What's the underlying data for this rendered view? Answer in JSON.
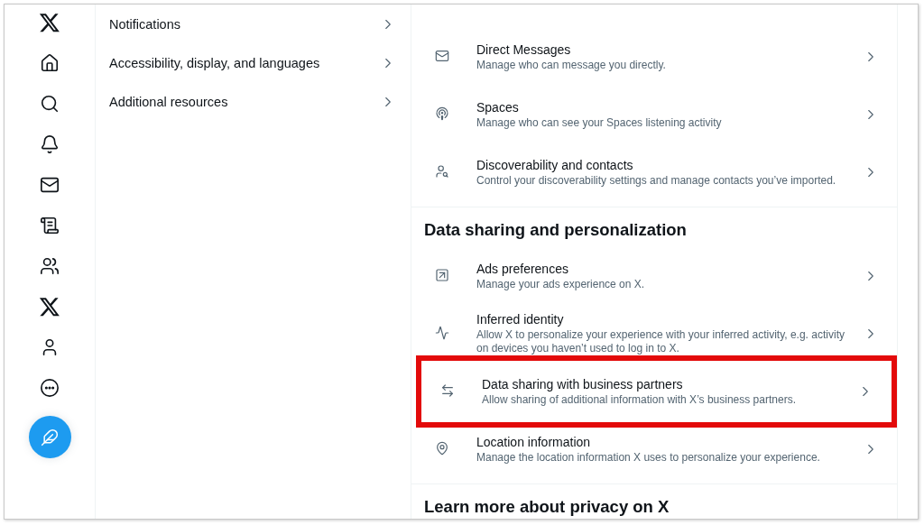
{
  "nav": [
    {
      "kind": "logo"
    },
    {
      "kind": "home"
    },
    {
      "kind": "search"
    },
    {
      "kind": "bell"
    },
    {
      "kind": "mail"
    },
    {
      "kind": "list"
    },
    {
      "kind": "people"
    },
    {
      "kind": "logo"
    },
    {
      "kind": "person"
    },
    {
      "kind": "more"
    },
    {
      "kind": "compose"
    }
  ],
  "settings_menu": [
    {
      "label": "Notifications"
    },
    {
      "label": "Accessibility, display, and languages"
    },
    {
      "label": "Additional resources"
    }
  ],
  "sections": [
    {
      "items": [
        {
          "title": "Direct Messages",
          "description": "Manage who can message you directly.",
          "highlighted": false
        },
        {
          "title": "Spaces",
          "description": "Manage who can see your Spaces listening activity",
          "highlighted": false
        },
        {
          "title": "Discoverability and contacts",
          "description": "Control your discoverability settings and manage contacts you’ve imported.",
          "highlighted": false
        }
      ]
    },
    {
      "heading": "Data sharing and personalization",
      "items": [
        {
          "title": "Ads preferences",
          "description": "Manage your ads experience on X.",
          "highlighted": false
        },
        {
          "title": "Inferred identity",
          "description": "Allow X to personalize your experience with your inferred activity, e.g. activity on devices you haven’t used to log in to X.",
          "highlighted": false
        },
        {
          "title": "Data sharing with business partners",
          "description": "Allow sharing of additional information with X’s business partners.",
          "highlighted": true
        },
        {
          "title": "Location information",
          "description": "Manage the location information X uses to personalize your experience.",
          "highlighted": false
        }
      ]
    },
    {
      "heading": "Learn more about privacy on X"
    }
  ]
}
